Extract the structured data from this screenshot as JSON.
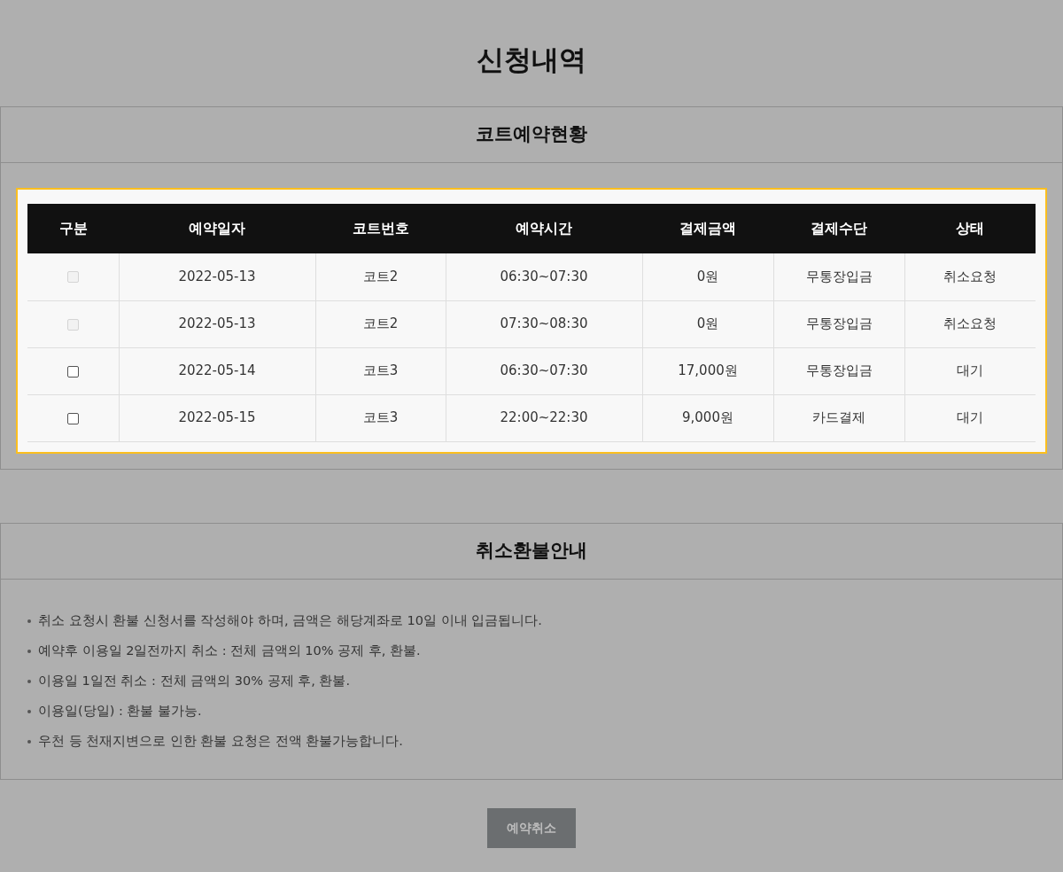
{
  "page_title": "신청내역",
  "reservations": {
    "title": "코트예약현황",
    "columns": [
      "구분",
      "예약일자",
      "코트번호",
      "예약시간",
      "결제금액",
      "결제수단",
      "상태"
    ],
    "rows": [
      {
        "checked": false,
        "disabled": true,
        "date": "2022-05-13",
        "court": "코트2",
        "time": "06:30~07:30",
        "amount": "0원",
        "method": "무통장입금",
        "status": "취소요청"
      },
      {
        "checked": false,
        "disabled": true,
        "date": "2022-05-13",
        "court": "코트2",
        "time": "07:30~08:30",
        "amount": "0원",
        "method": "무통장입금",
        "status": "취소요청"
      },
      {
        "checked": false,
        "disabled": false,
        "date": "2022-05-14",
        "court": "코트3",
        "time": "06:30~07:30",
        "amount": "17,000원",
        "method": "무통장입금",
        "status": "대기"
      },
      {
        "checked": false,
        "disabled": false,
        "date": "2022-05-15",
        "court": "코트3",
        "time": "22:00~22:30",
        "amount": "9,000원",
        "method": "카드결제",
        "status": "대기"
      }
    ]
  },
  "refund_info": {
    "title": "취소환불안내",
    "items": [
      "취소 요청시 환불 신청서를 작성해야 하며, 금액은 해당계좌로 10일 이내 입금됩니다.",
      "예약후 이용일 2일전까지 취소 : 전체 금액의 10% 공제 후, 환불.",
      "이용일 1일전 취소 : 전체 금액의 30% 공제 후, 환불.",
      "이용일(당일) : 환불 불가능.",
      "우천 등 천재지변으로 인한 환불 요청은 전액 환불가능합니다."
    ]
  },
  "cancel_button": "예약취소"
}
